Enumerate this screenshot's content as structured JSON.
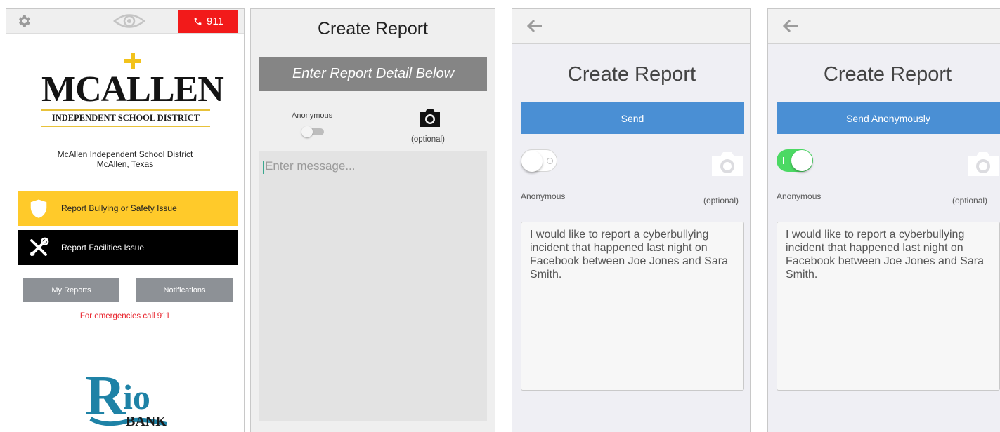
{
  "home": {
    "emergency_button": "911",
    "logo_name": "MCALLEN",
    "logo_subtitle": "INDEPENDENT SCHOOL DISTRICT",
    "district_name": "McAllen Independent School District",
    "district_city": "McAllen, Texas",
    "report_bullying": "Report Bullying or Safety Issue",
    "report_facilities": "Report Facilities Issue",
    "my_reports": "My Reports",
    "notifications": "Notifications",
    "emergency_note": "For emergencies call 911",
    "sponsor_logo": "Rio BANK",
    "colors": {
      "alert": "#f21a1a",
      "bullying": "#ffca2a",
      "emergency_text": "#e8222b"
    }
  },
  "create_report_android": {
    "title": "Create Report",
    "banner": "Enter Report Detail Below",
    "anonymous_label": "Anonymous",
    "anonymous_on": false,
    "camera_icon": "camera-icon",
    "optional_label": "(optional)",
    "message_placeholder": "Enter message..."
  },
  "create_report_ios_named": {
    "title": "Create Report",
    "send_button": "Send",
    "anonymous_on": false,
    "anonymous_label": "Anonymous",
    "optional_label": "(optional)",
    "message": "I would like to report a cyberbullying incident that happened last night on Facebook between Joe Jones and Sara Smith."
  },
  "create_report_ios_anonymous": {
    "title": "Create Report",
    "send_button": "Send Anonymously",
    "anonymous_on": true,
    "anonymous_label": "Anonymous",
    "optional_label": "(optional)",
    "message": "I would like to report a cyberbullying incident that happened last night on Facebook between Joe Jones and Sara Smith."
  }
}
